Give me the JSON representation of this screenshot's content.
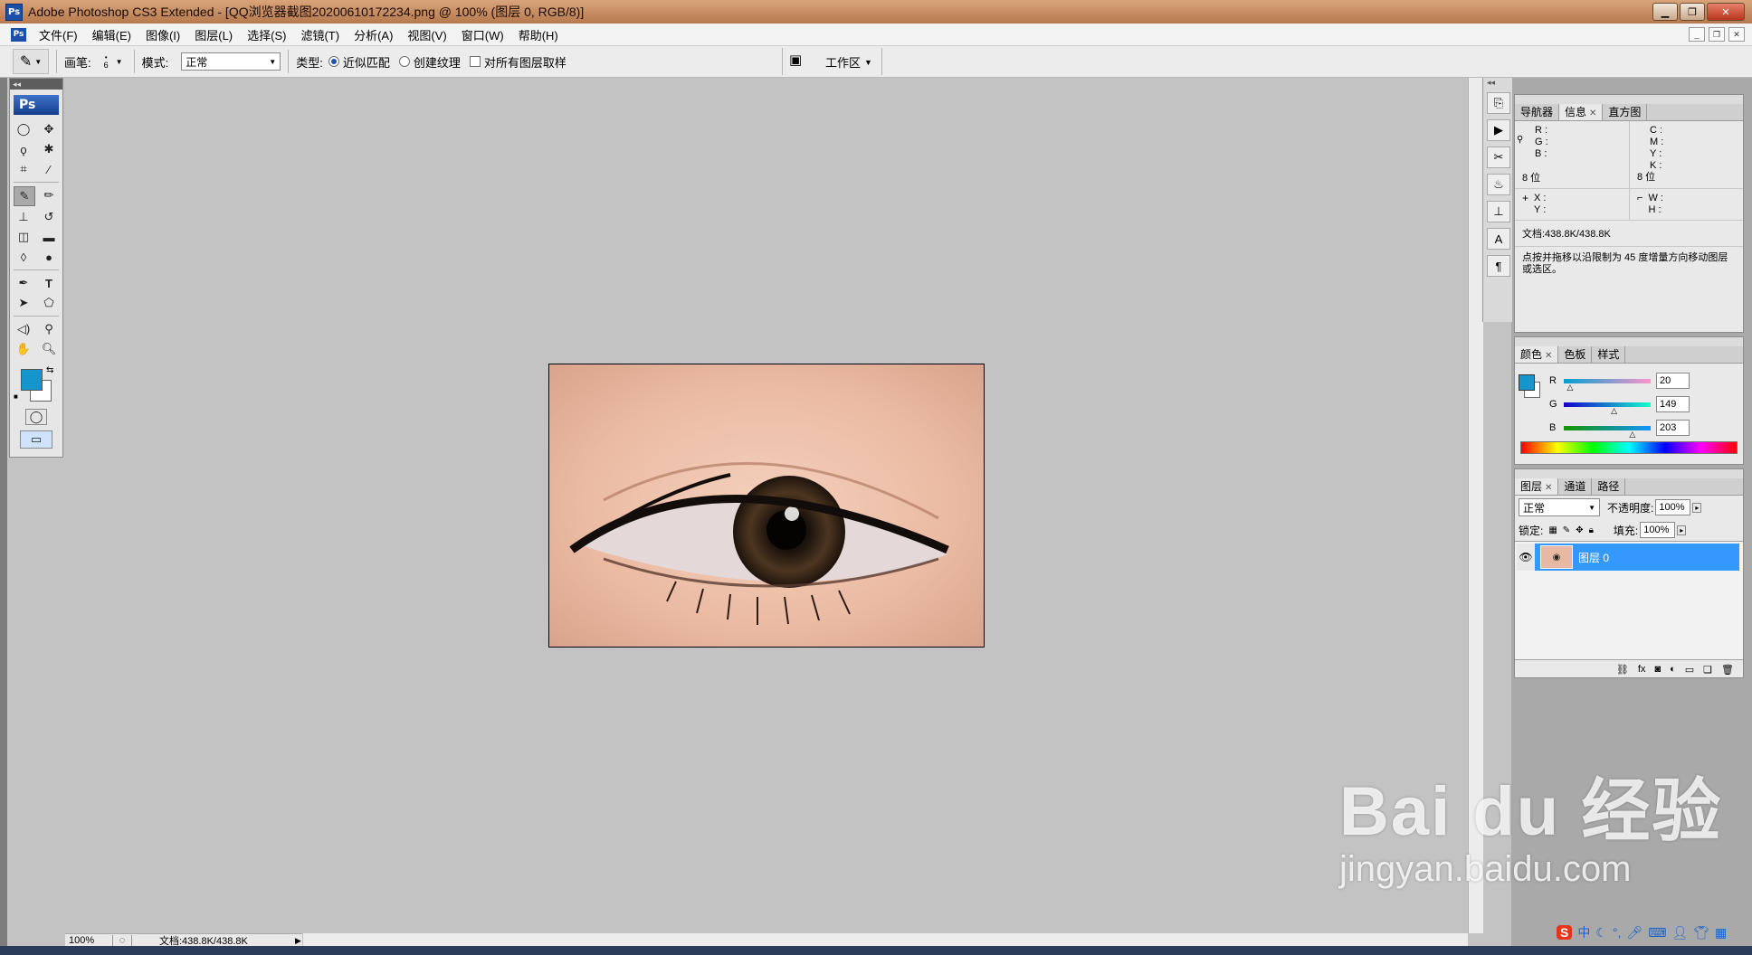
{
  "window": {
    "title": "Adobe Photoshop CS3 Extended - [QQ浏览器截图20200610172234.png @ 100% (图层 0, RGB/8)]",
    "app_icon": "Ps"
  },
  "menu": {
    "items": [
      "文件(F)",
      "编辑(E)",
      "图像(I)",
      "图层(L)",
      "选择(S)",
      "滤镜(T)",
      "分析(A)",
      "视图(V)",
      "窗口(W)",
      "帮助(H)"
    ]
  },
  "options": {
    "brush_label": "画笔:",
    "brush_size": "6",
    "mode_label": "模式:",
    "mode_value": "正常",
    "type_label": "类型:",
    "type_option_1": "近似匹配",
    "type_option_2": "创建纹理",
    "sample_all_label": "对所有图层取样",
    "workspace_label": "工作区"
  },
  "toolbox": {
    "logo": "Ps",
    "foreground_color": "#1495cb",
    "background_color": "#ffffff"
  },
  "status": {
    "zoom": "100%",
    "doc_size": "文档:438.8K/438.8K"
  },
  "info_panel": {
    "tabs": [
      "导航器",
      "信息",
      "直方图"
    ],
    "active_tab": "信息",
    "rgb": [
      "R :",
      "G :",
      "B :"
    ],
    "cmyk": [
      "C :",
      "M :",
      "Y :",
      "K :"
    ],
    "bit_left": "8 位",
    "bit_right": "8 位",
    "xy": [
      "X :",
      "Y :"
    ],
    "wh": [
      "W :",
      "H :"
    ],
    "doc": "文档:438.8K/438.8K",
    "hint": "点按并拖移以沿限制为 45 度增量方向移动图层或选区。"
  },
  "color_panel": {
    "tabs": [
      "颜色",
      "色板",
      "样式"
    ],
    "active_tab": "颜色",
    "channels": [
      {
        "label": "R",
        "value": "20",
        "fraction": 0.078
      },
      {
        "label": "G",
        "value": "149",
        "fraction": 0.584
      },
      {
        "label": "B",
        "value": "203",
        "fraction": 0.796
      }
    ],
    "swatch": "#1495cb"
  },
  "layers_panel": {
    "tabs": [
      "图层",
      "通道",
      "路径"
    ],
    "active_tab": "图层",
    "blend_mode": "正常",
    "opacity_label": "不透明度:",
    "opacity_value": "100%",
    "lock_label": "锁定:",
    "fill_label": "填充:",
    "fill_value": "100%",
    "layers": [
      {
        "name": "图层 0",
        "selected": true
      }
    ]
  },
  "watermark": {
    "brand": "Bai du 经验",
    "url": "jingyan.baidu.com"
  },
  "ime": {
    "label": "中"
  }
}
